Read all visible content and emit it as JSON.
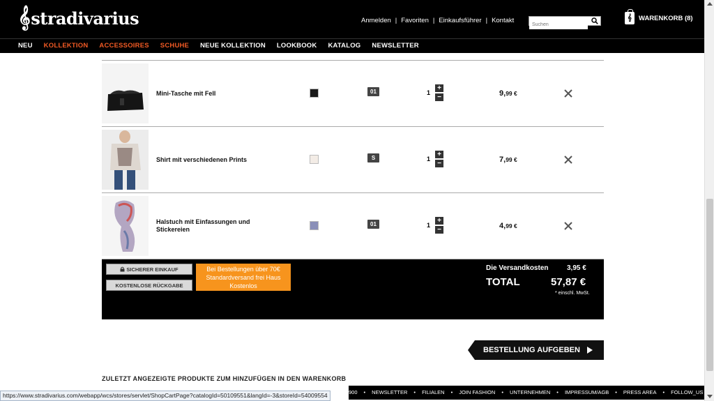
{
  "header": {
    "logo": "stradivarius",
    "links": [
      "Anmelden",
      "Favoriten",
      "Einkaufsführer",
      "Kontakt"
    ],
    "search_placeholder": "Suchen",
    "cart_label": "WARENKORB (8)"
  },
  "nav": {
    "items": [
      {
        "label": "NEU"
      },
      {
        "label": "KOLLEKTION"
      },
      {
        "label": "ACCESSOIRES"
      },
      {
        "label": "SCHUHE"
      },
      {
        "label": "NEUE KOLLEKTION"
      },
      {
        "label": "LOOKBOOK"
      },
      {
        "label": "KATALOG"
      },
      {
        "label": "NEWSLETTER"
      }
    ],
    "accent_color": "#f15a24"
  },
  "cart_items": [
    {
      "name": "Mini-Tasche mit Fell",
      "color": "#1a1a1a",
      "size": "01",
      "qty": "1",
      "price_main": "9,",
      "price_cents": "99 €"
    },
    {
      "name": "Shirt mit verschiedenen Prints",
      "color": "#f3ece6",
      "size": "S",
      "qty": "1",
      "price_main": "7,",
      "price_cents": "99 €"
    },
    {
      "name": "Halstuch mit Einfassungen und Stickereien",
      "color": "#8a8fb8",
      "size": "01",
      "qty": "1",
      "price_main": "4,",
      "price_cents": "99 €"
    }
  ],
  "summary": {
    "secure_button": "SICHERER EINKAUF",
    "returns_button": "KOSTENLOSE RÜCKGABE",
    "promo_text": "Bei Bestellungen über 70€ Standardversand frei Haus Kostenlos",
    "shipping_label": "Die Versandkosten",
    "shipping_value": "3,95 €",
    "total_label": "TOTAL",
    "total_value": "57,87 €",
    "vat_note": "* einschl. MwSt.",
    "promo_color": "#f7941d"
  },
  "checkout_button": "BESTELLUNG AUFGEBEN",
  "recent_heading": "ZULETZT ANGEZEIGTE PRODUKTE ZUM HINZUFÜGEN IN DEN WARENKORB",
  "footer": {
    "links": [
      "900",
      "NEWSLETTER",
      "FILIALEN",
      "JOIN FASHION",
      "UNTERNEHMEN",
      "IMPRESSUM/AGB",
      "PRESS AREA",
      "FOLLOW_US"
    ]
  },
  "status_url": "https://www.stradivarius.com/webapp/wcs/stores/servlet/ShopCartPage?catalogId=50109551&langId=-3&storeId=54009554"
}
